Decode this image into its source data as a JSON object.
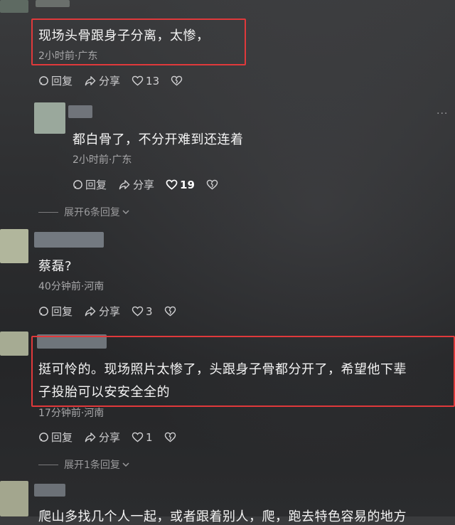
{
  "comments": [
    {
      "text": "现场头骨跟身子分离，太惨，",
      "meta": "2小时前·广东",
      "actions": {
        "reply": "回复",
        "share": "分享",
        "likes": "13"
      }
    },
    {
      "text": "都白骨了，不分开难到还连着",
      "meta": "2小时前·广东",
      "actions": {
        "reply": "回复",
        "share": "分享",
        "likes": "19"
      },
      "more": "···"
    },
    {
      "expand": "展开6条回复"
    },
    {
      "text": "蔡磊?",
      "meta": "40分钟前·河南",
      "actions": {
        "reply": "回复",
        "share": "分享",
        "likes": "3"
      }
    },
    {
      "text_line1": "挺可怜的。现场照片太惨了，头跟身子骨都分开了，希望他下辈",
      "text_line2": "子投胎可以安安全全的",
      "meta": "17分钟前·河南",
      "actions": {
        "reply": "回复",
        "share": "分享",
        "likes": "1"
      }
    },
    {
      "expand": "展开1条回复"
    },
    {
      "text": "爬山多找几个人一起，或者跟着别人，爬，跑去特色容易的地方"
    }
  ],
  "colors": {
    "highlight_box": "#e0393b",
    "text": "#f4f4f4",
    "meta": "#a8a8aa"
  }
}
